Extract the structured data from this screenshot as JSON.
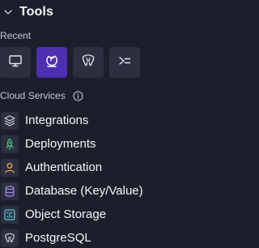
{
  "header": {
    "title": "Tools",
    "expanded": true,
    "icon": "chevron-down-icon"
  },
  "recent": {
    "label": "Recent",
    "items": [
      {
        "icon": "monitor-icon",
        "active": false
      },
      {
        "icon": "moon-flag-icon",
        "active": true
      },
      {
        "icon": "postgresql-elephant-icon",
        "active": false
      },
      {
        "icon": "shell-prompt-icon",
        "active": false
      }
    ]
  },
  "cloud_services": {
    "label": "Cloud Services",
    "info_icon": "info-icon",
    "items": [
      {
        "label": "Integrations",
        "icon": "layers-icon",
        "color": "#d0d3de"
      },
      {
        "label": "Deployments",
        "icon": "rocket-icon",
        "color": "#4ed07f"
      },
      {
        "label": "Authentication",
        "icon": "user-icon",
        "color": "#f0a64a"
      },
      {
        "label": "Database (Key/Value)",
        "icon": "database-icon",
        "color": "#a98bf0"
      },
      {
        "label": "Object Storage",
        "icon": "storage-icon",
        "color": "#5ec8d8"
      },
      {
        "label": "PostgreSQL",
        "icon": "postgresql-elephant-icon",
        "color": "#d0d3de"
      }
    ]
  },
  "colors": {
    "background": "#1c1f2b",
    "button_bg": "#2b2f3f",
    "active_bg": "#4d2fb0",
    "text": "#f5f6f8",
    "muted_text": "#c2c6d6"
  }
}
